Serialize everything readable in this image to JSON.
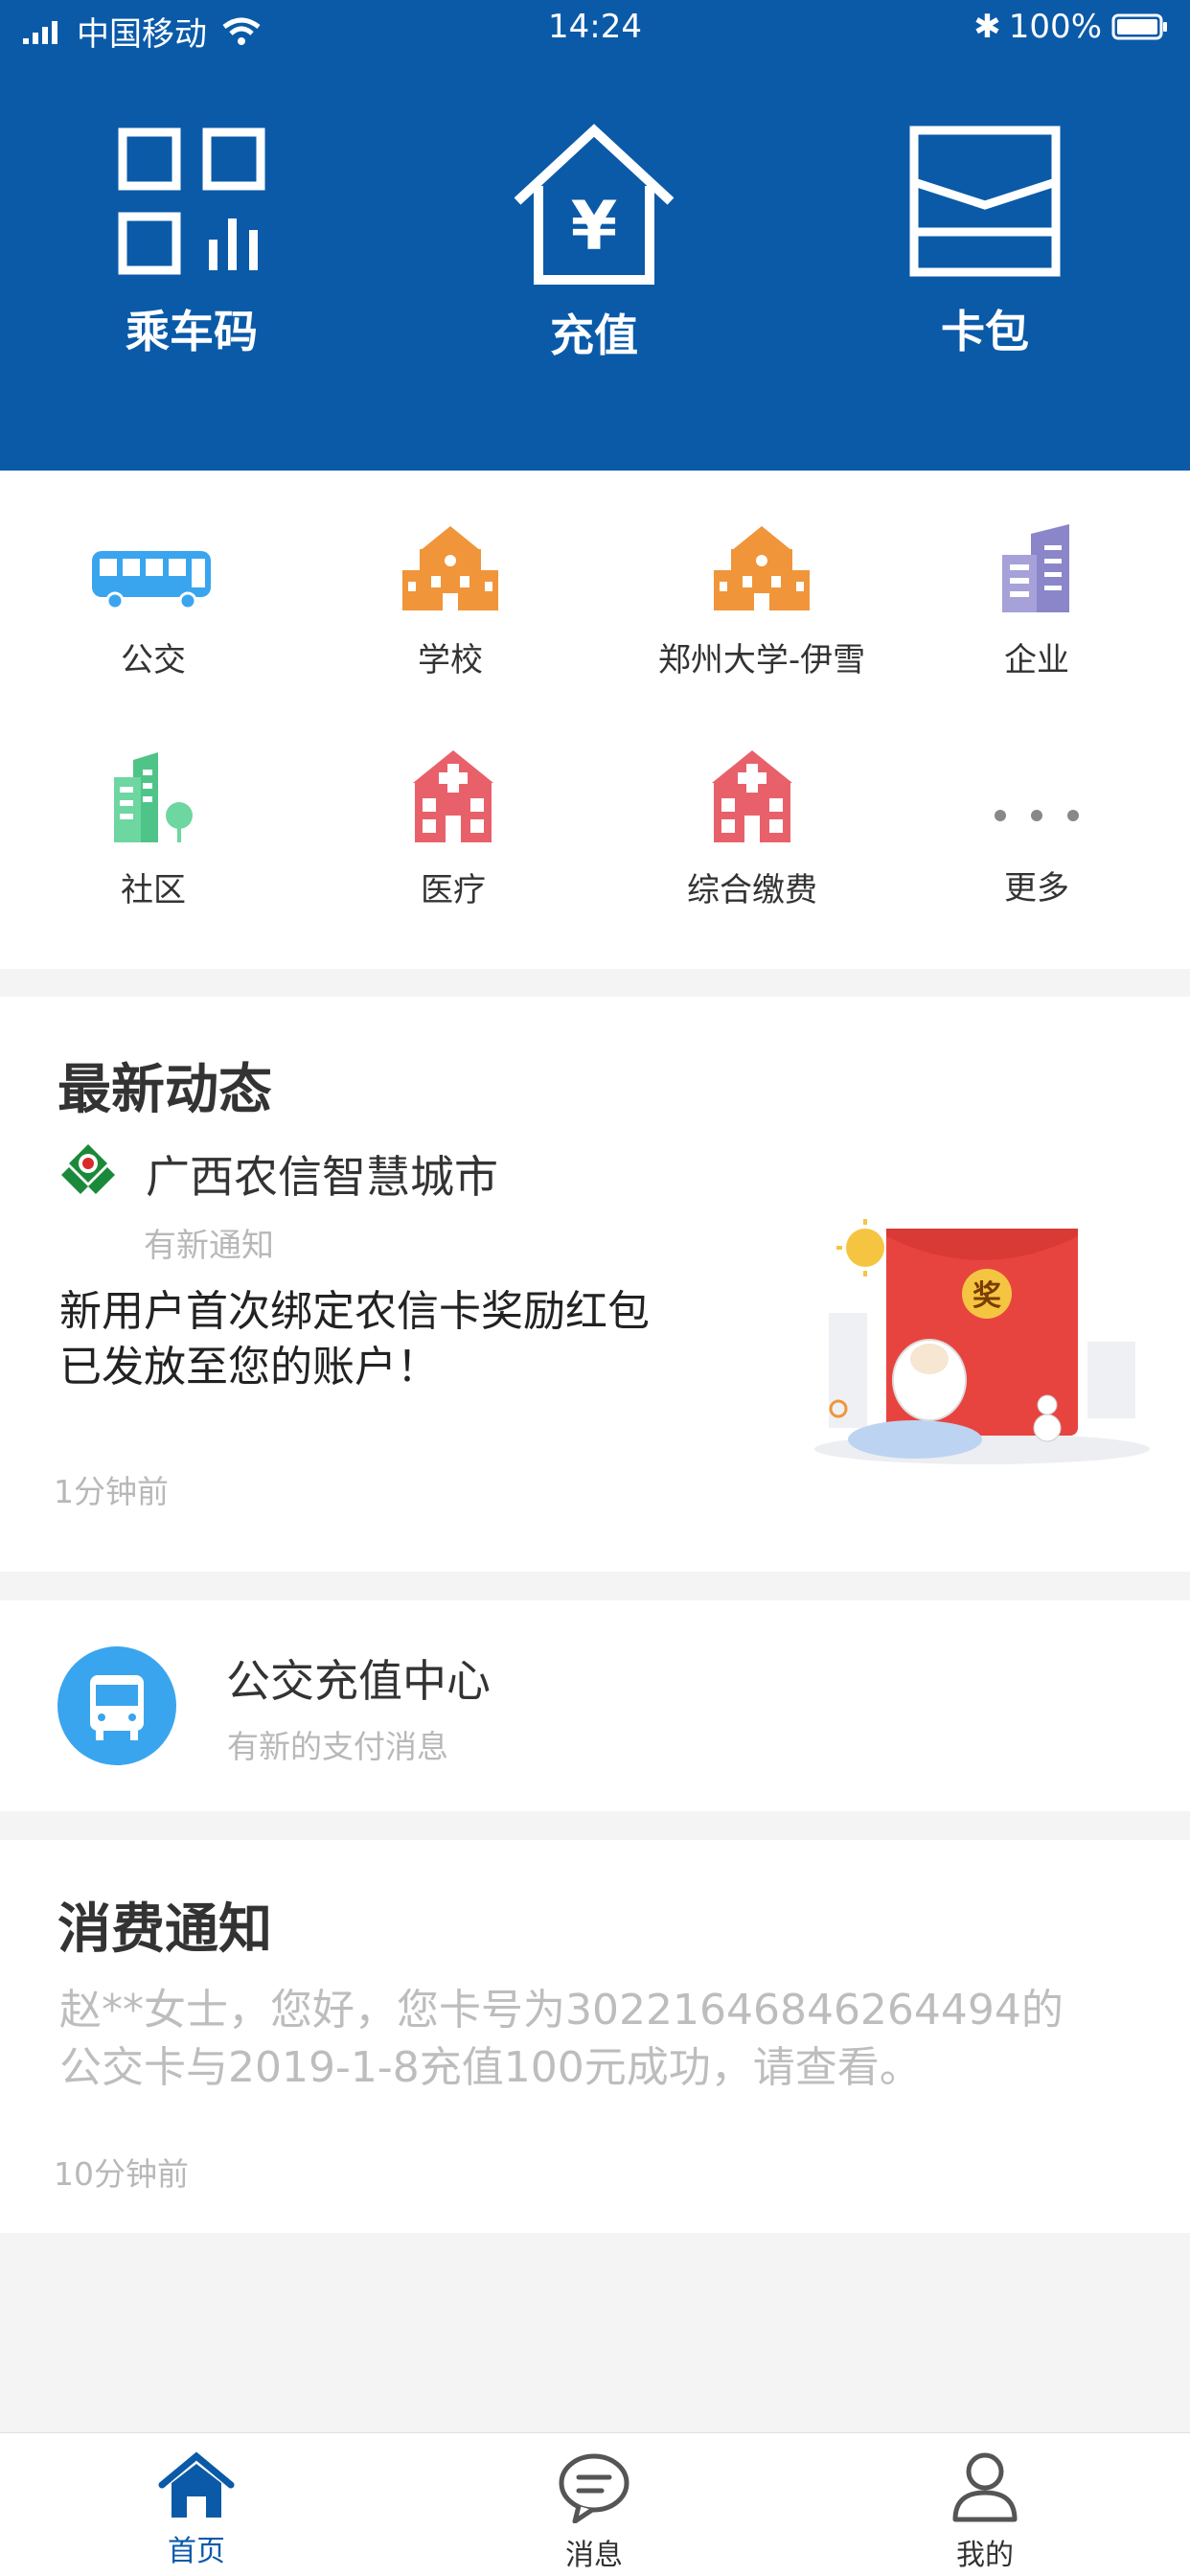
{
  "status_bar": {
    "carrier": "中国移动",
    "time": "14:24",
    "battery": "100%"
  },
  "header": {
    "items": [
      {
        "label": "乘车码",
        "icon": "qr-code-icon"
      },
      {
        "label": "充值",
        "icon": "yen-house-icon"
      },
      {
        "label": "卡包",
        "icon": "card-wallet-icon"
      }
    ]
  },
  "services": {
    "items": [
      {
        "label": "公交",
        "icon": "bus-icon"
      },
      {
        "label": "学校",
        "icon": "school-icon"
      },
      {
        "label": "郑州大学-伊雪",
        "icon": "school-icon"
      },
      {
        "label": "企业",
        "icon": "enterprise-building-icon"
      },
      {
        "label": "社区",
        "icon": "community-building-icon"
      },
      {
        "label": "医疗",
        "icon": "hospital-icon"
      },
      {
        "label": "综合缴费",
        "icon": "hospital-icon"
      },
      {
        "label": "更多",
        "icon": "more-dots-icon"
      }
    ]
  },
  "news": {
    "title": "最新动态",
    "source": "广西农信智慧城市",
    "subtitle": "有新通知",
    "message_line1": "新用户首次绑定农信卡奖励红包",
    "message_line2": "已发放至您的账户！",
    "time": "1分钟前",
    "badge": "奖"
  },
  "bus_center": {
    "title": "公交充值中心",
    "subtitle": "有新的支付消息"
  },
  "consumption": {
    "title": "消费通知",
    "message_line1": "赵**女士，您好，您卡号为3022164684626449​4的",
    "message_line2": "公交卡与2019-1-8充值100元成功，请查看。",
    "time": "10分钟前"
  },
  "tabbar": {
    "items": [
      {
        "label": "首页",
        "icon": "home-icon",
        "active": true
      },
      {
        "label": "消息",
        "icon": "message-icon",
        "active": false
      },
      {
        "label": "我的",
        "icon": "profile-icon",
        "active": false
      }
    ]
  },
  "colors": {
    "brand_blue": "#0a5aa8",
    "orange": "#f0953a",
    "red": "#e8616a",
    "green": "#6ed6a0",
    "purple": "#8b86c9",
    "bus_blue": "#3aa5ef"
  }
}
